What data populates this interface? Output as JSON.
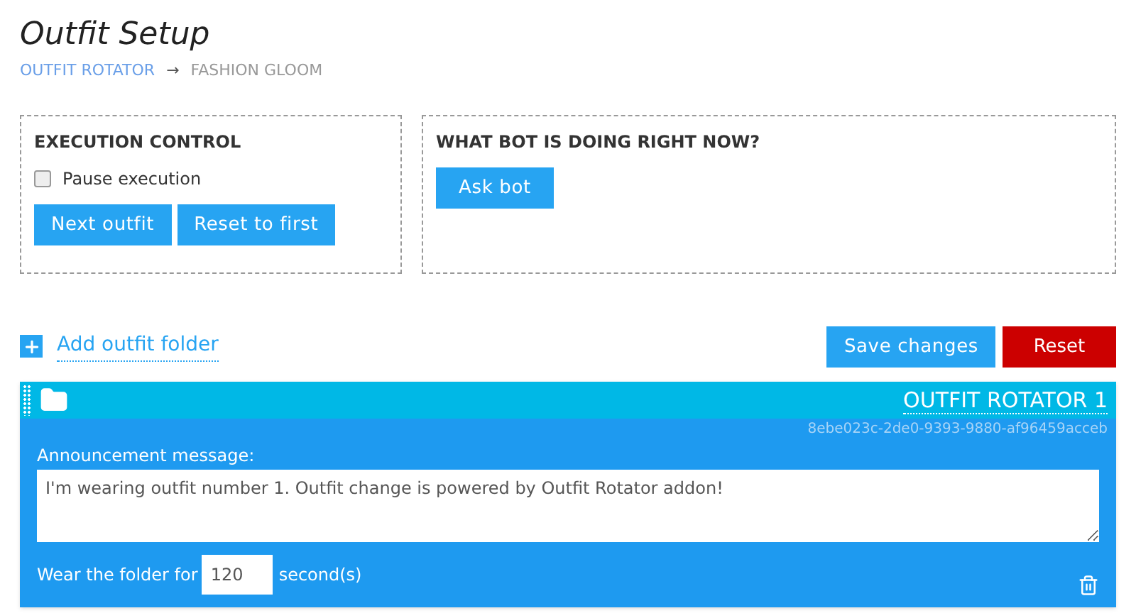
{
  "page": {
    "title": "Outfit Setup",
    "separator": "→",
    "breadcrumb": [
      {
        "label": "OUTFIT ROTATOR",
        "kind": "link"
      },
      {
        "label": "FASHION GLOOM",
        "kind": "current"
      }
    ]
  },
  "execution_control": {
    "title": "EXECUTION CONTROL",
    "pause": {
      "label": "Pause execution",
      "checked": false
    },
    "buttons": [
      "Next outfit",
      "Reset to first"
    ]
  },
  "bot_status": {
    "title": "WHAT BOT IS DOING RIGHT NOW?",
    "button": "Ask bot"
  },
  "toolbar": {
    "add_folder": "Add outfit folder",
    "save": "Save changes",
    "reset": "Reset"
  },
  "folder": {
    "name": "OUTFIT ROTATOR 1",
    "id": "8ebe023c-2de0-9393-9880-af96459acceb",
    "message_label": "Announcement message:",
    "message": "I'm wearing outfit number 1. Outfit change is powered by Outfit Rotator addon!",
    "duration_label": "Wear the folder for",
    "duration": "120",
    "duration_unit": "second(s)"
  }
}
